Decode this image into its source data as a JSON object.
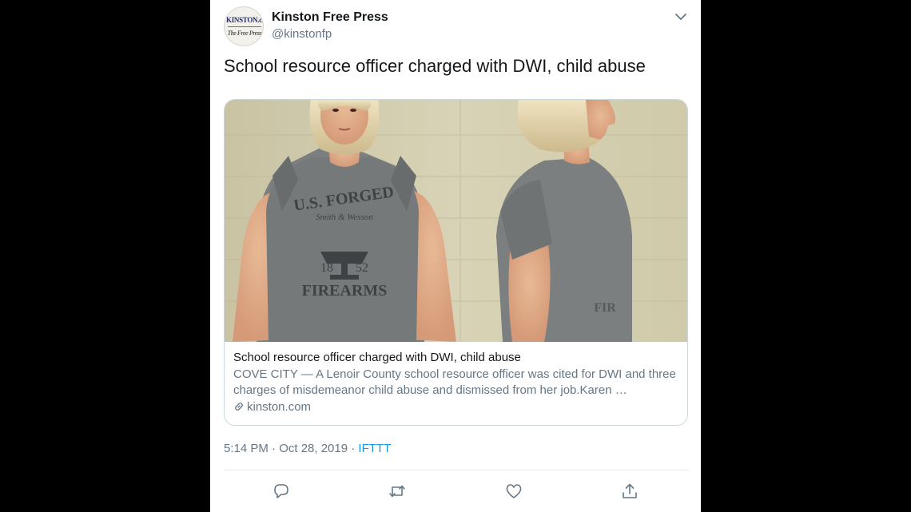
{
  "account": {
    "name": "Kinston Free Press",
    "handle": "@kinstonfp",
    "avatar_line1": "KINSTON.com",
    "avatar_line2": "The Free Press"
  },
  "tweet": {
    "text": "School resource officer charged with DWI, child abuse",
    "timestamp": "5:14 PM · Oct 28, 2019 · ",
    "source": "IFTTT"
  },
  "card": {
    "title": "School resource officer charged with DWI, child abuse",
    "description": "COVE CITY — A Lenoir County school resource officer was cited for DWI and three charges of misdemeanor child abuse and dismissed from her job.Karen …",
    "domain": "kinston.com",
    "shirt_line1": "U.S. FORGED",
    "shirt_line2": "Smith & Wesson",
    "shirt_year_left": "18",
    "shirt_year_right": "52",
    "shirt_line3": "FIREARMS",
    "shirt_side": "FIR"
  },
  "colors": {
    "text_primary": "#14171a",
    "text_secondary": "#657786",
    "link_blue": "#1b95e0",
    "border": "#ccd6dd",
    "background": "#000000"
  },
  "icons": [
    "chevron-down-icon",
    "link-icon",
    "reply-icon",
    "retweet-icon",
    "like-icon",
    "share-icon"
  ]
}
